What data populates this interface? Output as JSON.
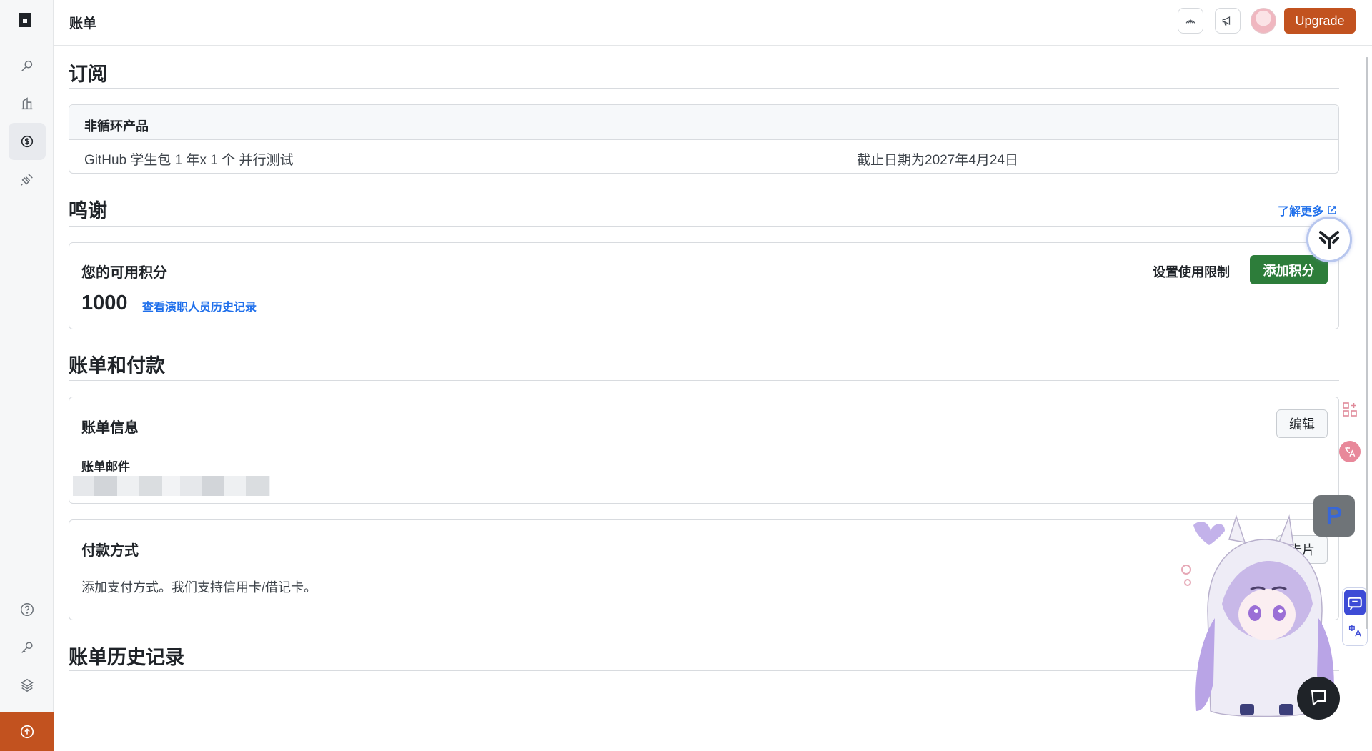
{
  "header": {
    "title": "账单",
    "upgrade_label": "Upgrade"
  },
  "subscriptions": {
    "title": "订阅",
    "table_header": "非循环产品",
    "rows": [
      {
        "name": "GitHub 学生包 1 年x 1 个 并行测试",
        "date": "截止日期为2027年4月24日"
      }
    ]
  },
  "sponsorship": {
    "title": "鸣谢",
    "learn_more": "了解更多",
    "credits_label": "您的可用积分",
    "credits_value": "1000",
    "history_link": "查看演职人员历史记录",
    "limit_label": "设置使用限制",
    "add_credits_label": "添加积分"
  },
  "billing": {
    "title": "账单和付款",
    "info_title": "账单信息",
    "edit_label": "编辑",
    "email_label": "账单邮件",
    "payment_title": "付款方式",
    "payment_text": "添加支付方式。我们支持信用卡/借记卡。",
    "payment_button": "卡片"
  },
  "history": {
    "title": "账单历史记录"
  },
  "widgets": {
    "p_label": "P"
  },
  "colors": {
    "accent": "#c2521f",
    "link": "#1f6feb",
    "success": "#2d7d3a"
  }
}
